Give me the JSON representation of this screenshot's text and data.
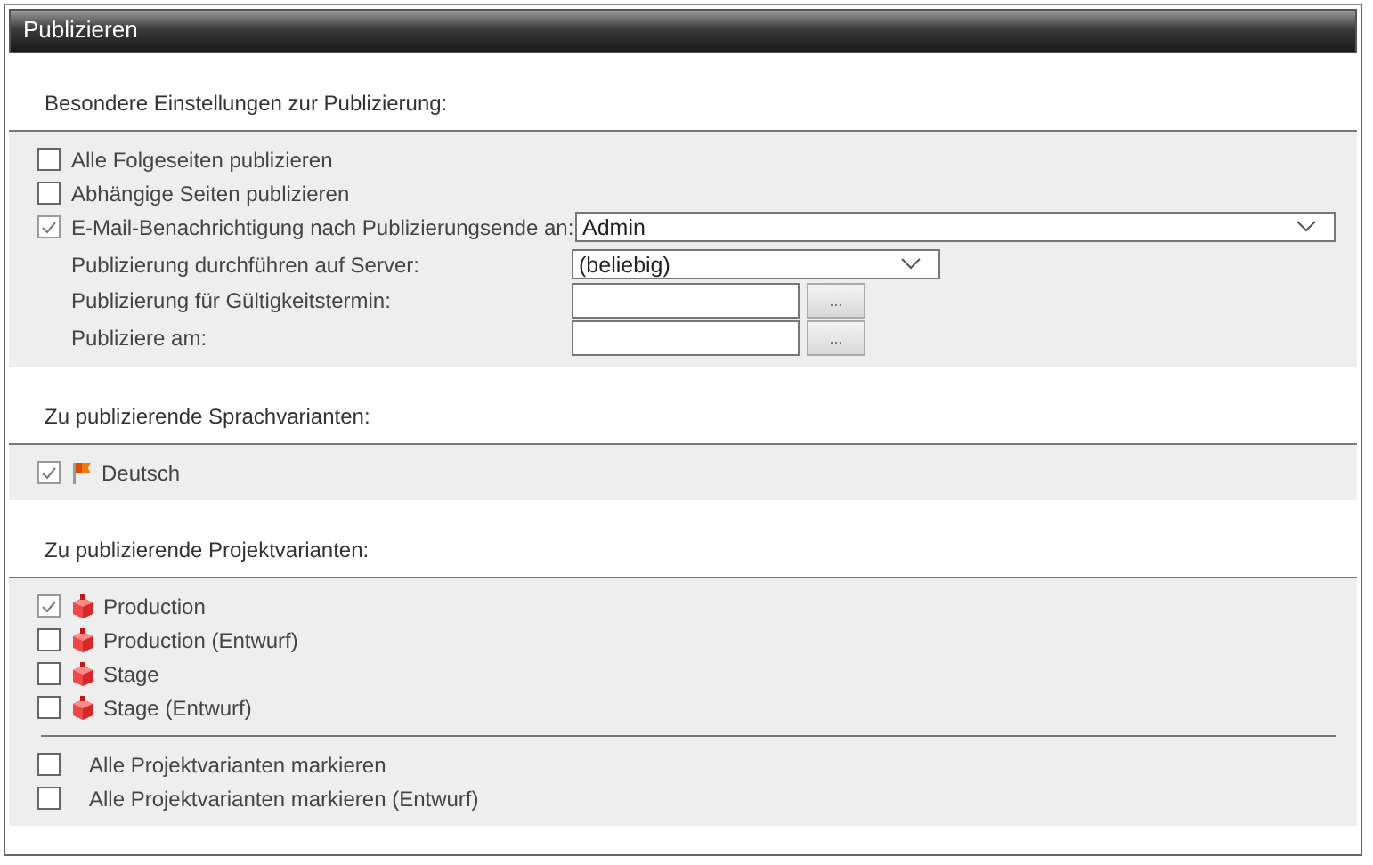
{
  "window": {
    "title": "Publizieren"
  },
  "sections": [
    {
      "heading": "Besondere Einstellungen zur Publizierung:",
      "groups": [
        [
          {
            "kind": "checkbox",
            "label": "Alle Folgeseiten publizieren",
            "checked": false
          },
          {
            "kind": "checkbox",
            "label": "Abhängige Seiten publizieren",
            "checked": false
          },
          {
            "kind": "checkbox-select",
            "label": "E-Mail-Benachrichtigung nach Publizierungsende an:",
            "checked": true,
            "value": "Admin"
          },
          {
            "kind": "select",
            "label": "Publizierung durchführen auf Server:",
            "value": "(beliebig)"
          },
          {
            "kind": "date",
            "label": "Publizierung für Gültigkeitstermin:",
            "button": "..."
          },
          {
            "kind": "date",
            "label": "Publiziere am:",
            "button": "..."
          }
        ]
      ]
    },
    {
      "heading": "Zu publizierende Sprachvarianten:",
      "groups": [
        [
          {
            "kind": "language",
            "label": "Deutsch",
            "checked": true
          }
        ]
      ]
    },
    {
      "heading": "Zu publizierende Projektvarianten:",
      "groups": [
        [
          {
            "kind": "project",
            "label": "Production",
            "checked": true
          },
          {
            "kind": "project",
            "label": "Production (Entwurf)",
            "checked": false
          },
          {
            "kind": "project",
            "label": "Stage",
            "checked": false
          },
          {
            "kind": "project",
            "label": "Stage (Entwurf)",
            "checked": false
          }
        ],
        [
          {
            "kind": "mark-all",
            "label": "Alle Projektvarianten markieren",
            "checked": false
          },
          {
            "kind": "mark-all",
            "label": "Alle Projektvarianten markieren (Entwurf)",
            "checked": false
          }
        ]
      ]
    }
  ]
}
